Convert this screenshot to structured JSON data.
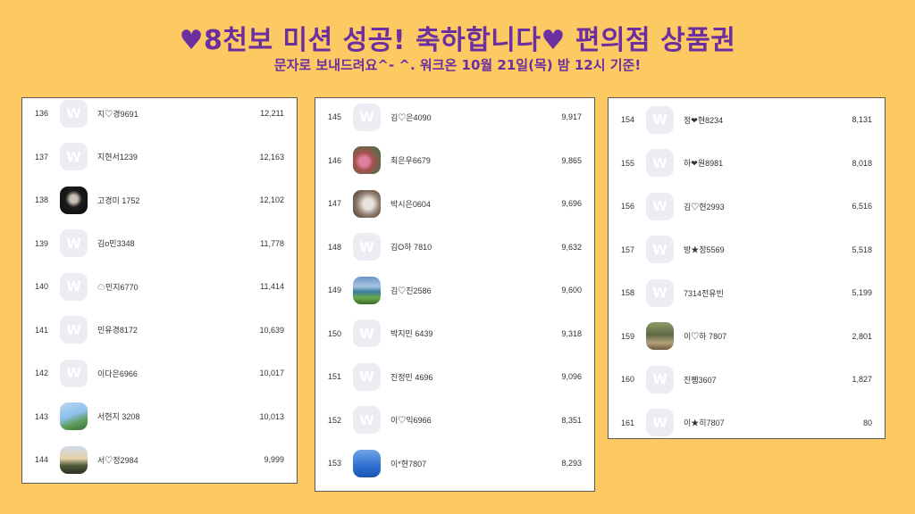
{
  "header": {
    "title": "♥8천보 미션 성공! 축하합니다♥ 편의점 상품권",
    "subtitle": "문자로 보내드려요^- ^. 워크온 10월 21일(목) 밤 12시 기준!"
  },
  "colors": {
    "background": "#FDC962",
    "title": "#6B2FA0",
    "avatar_placeholder": "#ECEDF2"
  },
  "avatar_placeholder_glyph": "W",
  "panels": [
    {
      "rows": [
        {
          "rank": "136",
          "name": "지♡경9691",
          "steps": "12,211",
          "avatar": "default"
        },
        {
          "rank": "137",
          "name": "지현서1239",
          "steps": "12,163",
          "avatar": "default"
        },
        {
          "rank": "138",
          "name": "고경미 1752",
          "steps": "12,102",
          "avatar": "photo-dark"
        },
        {
          "rank": "139",
          "name": "김o민3348",
          "steps": "11,778",
          "avatar": "default"
        },
        {
          "rank": "140",
          "name": "☁민지6770",
          "steps": "11,414",
          "avatar": "default"
        },
        {
          "rank": "141",
          "name": "민유경8172",
          "steps": "10,639",
          "avatar": "default"
        },
        {
          "rank": "142",
          "name": "이다은6966",
          "steps": "10,017",
          "avatar": "default"
        },
        {
          "rank": "143",
          "name": "서현지 3208",
          "steps": "10,013",
          "avatar": "photo-tree"
        },
        {
          "rank": "144",
          "name": "서♡정2984",
          "steps": "9,999",
          "avatar": "photo-sunset"
        }
      ]
    },
    {
      "rows": [
        {
          "rank": "145",
          "name": "김♡은4090",
          "steps": "9,917",
          "avatar": "default"
        },
        {
          "rank": "146",
          "name": "최은우6679",
          "steps": "9,865",
          "avatar": "photo-flower"
        },
        {
          "rank": "147",
          "name": "박시은0604",
          "steps": "9,696",
          "avatar": "photo-cat"
        },
        {
          "rank": "148",
          "name": "김O하 7810",
          "steps": "9,632",
          "avatar": "default"
        },
        {
          "rank": "149",
          "name": "김♡진2586",
          "steps": "9,600",
          "avatar": "photo-park"
        },
        {
          "rank": "150",
          "name": "박지민 6439",
          "steps": "9,318",
          "avatar": "default"
        },
        {
          "rank": "151",
          "name": "진정민 4696",
          "steps": "9,096",
          "avatar": "default"
        },
        {
          "rank": "152",
          "name": "이♡익6966",
          "steps": "8,351",
          "avatar": "default"
        },
        {
          "rank": "153",
          "name": "이*현7807",
          "steps": "8,293",
          "avatar": "photo-sky"
        }
      ]
    },
    {
      "rows": [
        {
          "rank": "154",
          "name": "정❤현8234",
          "steps": "8,131",
          "avatar": "default"
        },
        {
          "rank": "155",
          "name": "하❤원8981",
          "steps": "8,018",
          "avatar": "default"
        },
        {
          "rank": "156",
          "name": "김♡현2993",
          "steps": "6,516",
          "avatar": "default"
        },
        {
          "rank": "157",
          "name": "방★정5569",
          "steps": "5,518",
          "avatar": "default"
        },
        {
          "rank": "158",
          "name": "7314전유빈",
          "steps": "5,199",
          "avatar": "default"
        },
        {
          "rank": "159",
          "name": "이♡하 7807",
          "steps": "2,801",
          "avatar": "photo-yard"
        },
        {
          "rank": "160",
          "name": "진쨍3607",
          "steps": "1,827",
          "avatar": "default"
        },
        {
          "rank": "161",
          "name": "이★히7807",
          "steps": "80",
          "avatar": "default"
        }
      ]
    }
  ]
}
